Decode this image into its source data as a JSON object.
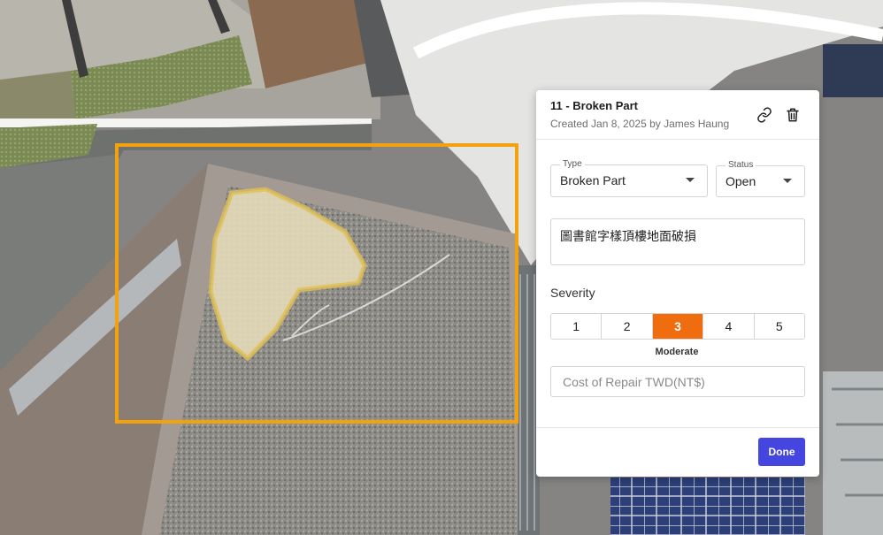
{
  "annotation": {
    "title": "11 - Broken Part",
    "created": "Created Jan 8, 2025 by James Haung",
    "icons": {
      "link": "link-icon",
      "delete": "trash-icon"
    },
    "type_field": {
      "legend": "Type",
      "value": "Broken Part"
    },
    "status_field": {
      "legend": "Status",
      "value": "Open"
    },
    "description": "圖書館字樣頂樓地面破損",
    "severity": {
      "label": "Severity",
      "options": [
        "1",
        "2",
        "3",
        "4",
        "5"
      ],
      "selected": "3",
      "caption": "Moderate"
    },
    "cost": {
      "placeholder": "Cost of Repair TWD(NT$)",
      "value": ""
    },
    "done_label": "Done"
  },
  "colors": {
    "bbox": "#f2a20c",
    "severity_active": "#ef6d0e",
    "done": "#4545e0"
  }
}
